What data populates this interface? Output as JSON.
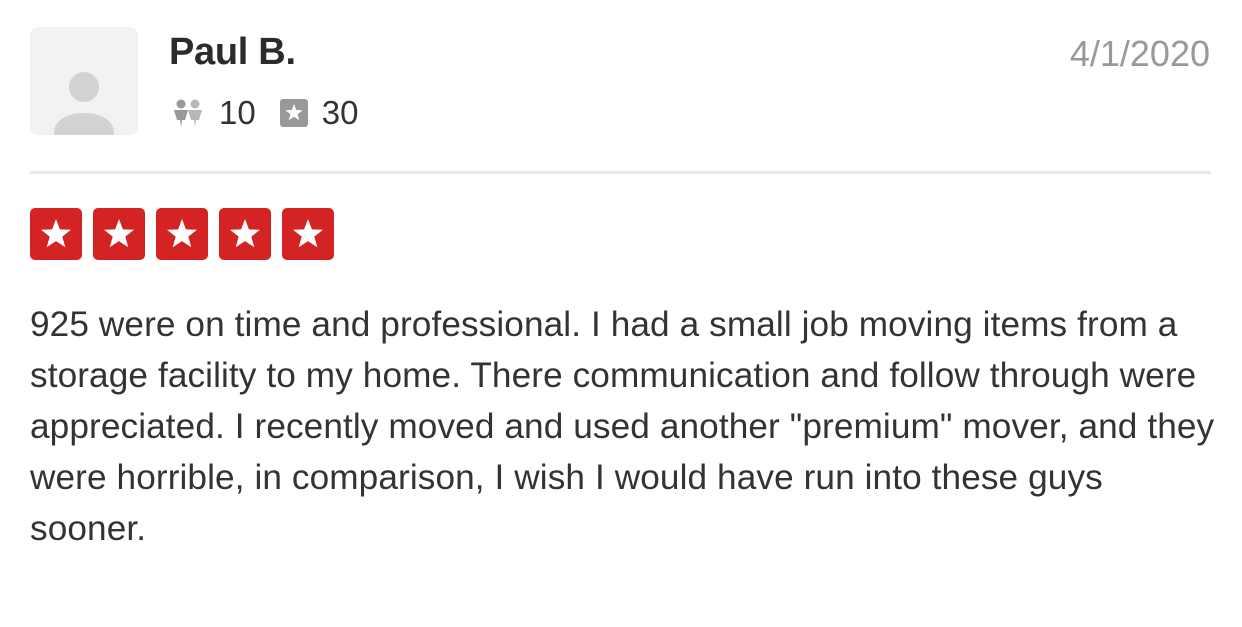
{
  "review": {
    "author": {
      "name": "Paul B.",
      "friends_count": "10",
      "reviews_count": "30",
      "avatar_icon": "default-user-avatar-icon",
      "friends_icon": "friends-icon",
      "reviews_icon": "review-star-icon"
    },
    "date": "4/1/2020",
    "rating": 5,
    "rating_max": 5,
    "star_color": "#d32323",
    "text": "925 were on time and professional. I had a small job moving items from a storage facility to my home. There communication and follow through were appreciated. I recently moved and used another \"premium\" mover, and they were horrible, in comparison, I wish I would have run into these guys sooner."
  }
}
